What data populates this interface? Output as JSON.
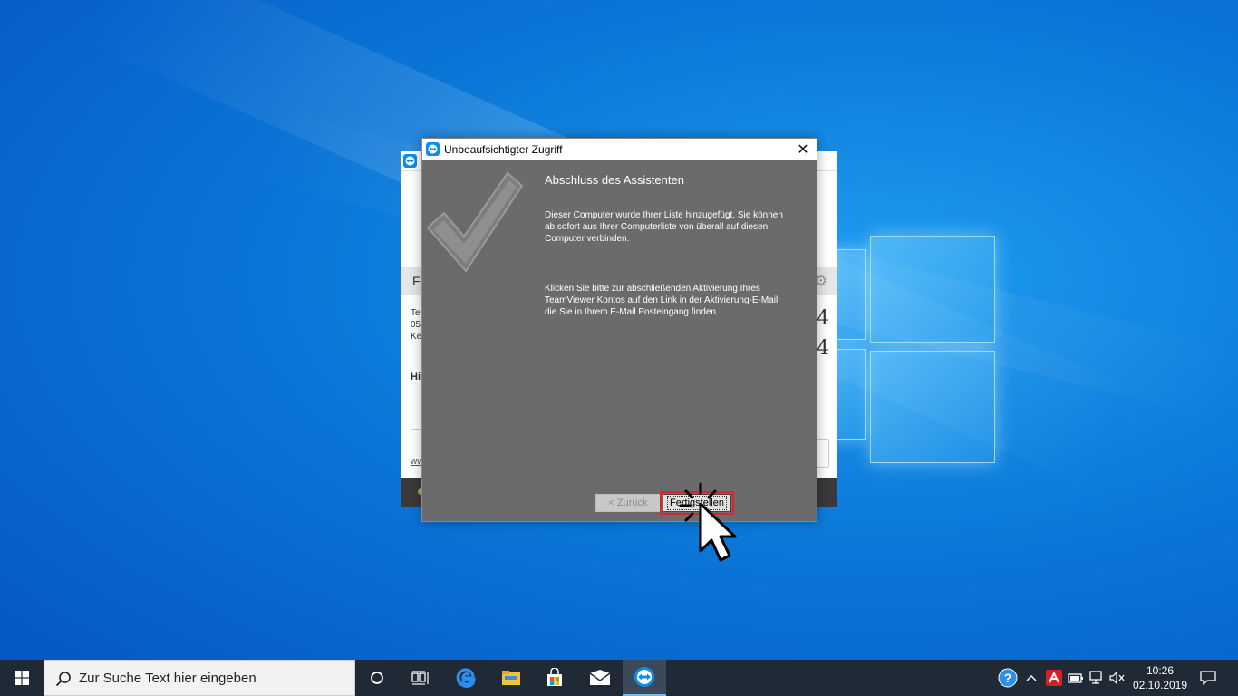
{
  "dialog": {
    "title": "Unbeaufsichtigter Zugriff",
    "close_glyph": "✕",
    "heading": "Abschluss des Assistenten",
    "paragraph1": "Dieser Computer wurde Ihrer Liste hinzugefügt. Sie können ab sofort aus Ihrer Computerliste von überall auf diesen Computer verbinden.",
    "paragraph2": "Klicken Sie bitte zur abschließenden Aktivierung Ihres TeamViewer Kontos auf den Link in der Aktivierung-E-Mail die Sie in Ihrem E-Mail Posteingang finden.",
    "back_label": "< Zurück",
    "finish_label": "Fertigstellen",
    "icon": "checkmark-icon",
    "highlight_color": "#e0202b"
  },
  "background_window": {
    "band_text": "Fe",
    "lines": [
      "Te",
      "05",
      "Ke"
    ],
    "bold_text": "Hi",
    "big_digits": [
      "4",
      "4"
    ],
    "link_text": "ww"
  },
  "taskbar": {
    "search_placeholder": "Zur Suche Text hier eingeben",
    "icons": [
      "windows-start-icon",
      "cortana-icon",
      "task-view-icon",
      "edge-icon",
      "file-explorer-icon",
      "store-icon",
      "mail-icon",
      "teamviewer-icon"
    ],
    "tray_icons": [
      "help-icon",
      "show-hidden-icons-chevron",
      "avira-icon",
      "battery-icon",
      "network-icon",
      "volume-muted-icon",
      "notification-icon"
    ],
    "time": "10:26",
    "date": "02.10.2019"
  }
}
